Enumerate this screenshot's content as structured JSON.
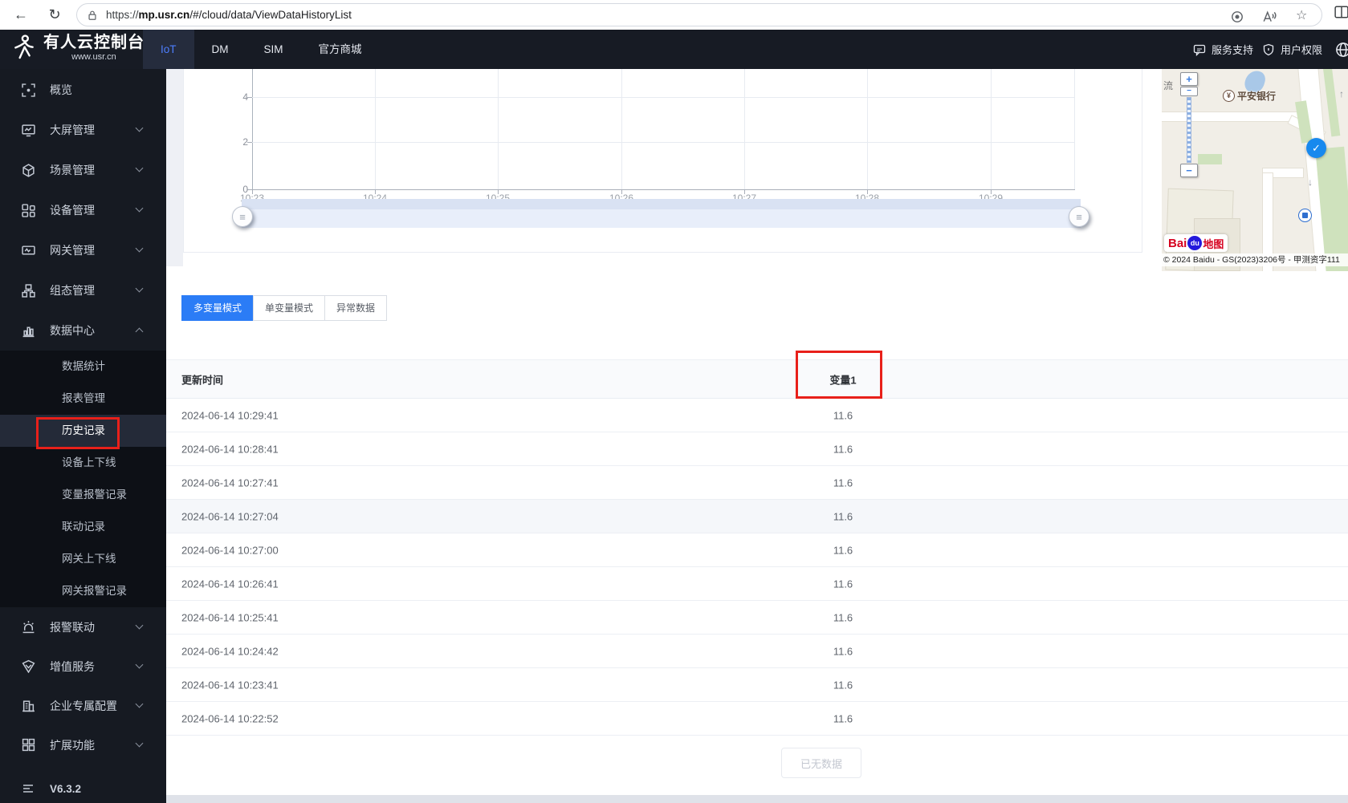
{
  "browser": {
    "url_scheme": "https://",
    "url_domain": "mp.usr.cn",
    "url_path": "/#/cloud/data/ViewDataHistoryList"
  },
  "header": {
    "title": "有人云控制台",
    "subtitle": "www.usr.cn",
    "nav": [
      {
        "label": "IoT",
        "active": true
      },
      {
        "label": "DM",
        "active": false
      },
      {
        "label": "SIM",
        "active": false
      },
      {
        "label": "官方商城",
        "active": false
      }
    ],
    "support_label": "服务支持",
    "permission_label": "用户权限",
    "accent_color": "#4d7efe"
  },
  "sidebar": {
    "items": [
      {
        "label": "概览",
        "icon": "overview-icon",
        "expandable": false
      },
      {
        "label": "大屏管理",
        "icon": "screen-icon",
        "expandable": true
      },
      {
        "label": "场景管理",
        "icon": "scene-icon",
        "expandable": true
      },
      {
        "label": "设备管理",
        "icon": "device-icon",
        "expandable": true
      },
      {
        "label": "网关管理",
        "icon": "gateway-icon",
        "expandable": true
      },
      {
        "label": "组态管理",
        "icon": "scada-icon",
        "expandable": true
      },
      {
        "label": "数据中心",
        "icon": "datacenter-icon",
        "expandable": true,
        "expanded": true
      }
    ],
    "submenu": [
      {
        "label": "数据统计",
        "active": false
      },
      {
        "label": "报表管理",
        "active": false
      },
      {
        "label": "历史记录",
        "active": true
      },
      {
        "label": "设备上下线",
        "active": false
      },
      {
        "label": "变量报警记录",
        "active": false
      },
      {
        "label": "联动记录",
        "active": false
      },
      {
        "label": "网关上下线",
        "active": false
      },
      {
        "label": "网关报警记录",
        "active": false
      }
    ],
    "bottom_items": [
      {
        "label": "报警联动",
        "icon": "alarm-icon"
      },
      {
        "label": "增值服务",
        "icon": "value-service-icon"
      },
      {
        "label": "企业专属配置",
        "icon": "enterprise-icon"
      },
      {
        "label": "扩展功能",
        "icon": "extend-icon"
      }
    ],
    "version": "V6.3.2"
  },
  "chart_data": {
    "type": "line",
    "categories": [
      "10:23",
      "10:24",
      "10:25",
      "10:26",
      "10:27",
      "10:28",
      "10:29"
    ],
    "y_tick_labels": [
      "0",
      "2",
      "4"
    ],
    "ylim": [
      0,
      5
    ],
    "series": [],
    "grid": true,
    "legend": null,
    "has_datazoom_slider": true
  },
  "tabs": {
    "items": [
      {
        "label": "多变量模式",
        "active": true
      },
      {
        "label": "单变量模式",
        "active": false
      },
      {
        "label": "异常数据",
        "active": false
      }
    ]
  },
  "table": {
    "columns": [
      {
        "label": "更新时间"
      },
      {
        "label": "变量1"
      }
    ],
    "rows": [
      {
        "time": "2024-06-14 10:29:41",
        "value": "11.6"
      },
      {
        "time": "2024-06-14 10:28:41",
        "value": "11.6"
      },
      {
        "time": "2024-06-14 10:27:41",
        "value": "11.6"
      },
      {
        "time": "2024-06-14 10:27:04",
        "value": "11.6"
      },
      {
        "time": "2024-06-14 10:27:00",
        "value": "11.6"
      },
      {
        "time": "2024-06-14 10:26:41",
        "value": "11.6"
      },
      {
        "time": "2024-06-14 10:25:41",
        "value": "11.6"
      },
      {
        "time": "2024-06-14 10:24:42",
        "value": "11.6"
      },
      {
        "time": "2024-06-14 10:23:41",
        "value": "11.6"
      },
      {
        "time": "2024-06-14 10:22:52",
        "value": "11.6"
      }
    ],
    "end_label": "已无数据"
  },
  "map": {
    "street_label": "流",
    "bank_label": "平安银行",
    "bank_symbol": "¥",
    "zoom_in": "+",
    "zoom_out": "−",
    "marker_glyph": "✓",
    "arrow_down": "↓",
    "arrow_up": "↑",
    "logo_bai": "Bai",
    "logo_du": "du",
    "logo_map": "地图",
    "copyright": "© 2024 Baidu - GS(2023)3206号 - 甲测资字111"
  }
}
